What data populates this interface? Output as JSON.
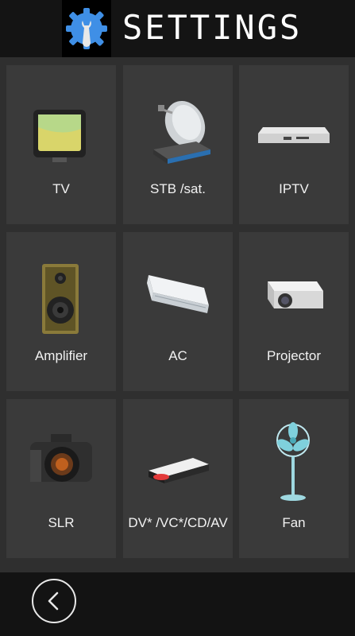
{
  "header": {
    "title": "SETTINGS",
    "logo_icon": "gear-wrench-icon"
  },
  "devices": [
    {
      "label": "TV",
      "icon": "tv-icon"
    },
    {
      "label": "STB /sat.",
      "icon": "satellite-dish-icon"
    },
    {
      "label": "IPTV",
      "icon": "iptv-box-icon"
    },
    {
      "label": "Amplifier",
      "icon": "speaker-icon"
    },
    {
      "label": "AC",
      "icon": "air-conditioner-icon"
    },
    {
      "label": "Projector",
      "icon": "projector-icon"
    },
    {
      "label": "SLR",
      "icon": "camera-icon"
    },
    {
      "label": "DV* /VC*/CD/AV",
      "icon": "disc-player-icon"
    },
    {
      "label": "Fan",
      "icon": "fan-icon"
    }
  ],
  "footer": {
    "back_icon": "chevron-left-icon"
  },
  "colors": {
    "accent": "#3f8fe6",
    "tile": "#3a3a3a",
    "background": "#2f2f2f",
    "header": "#141414"
  }
}
